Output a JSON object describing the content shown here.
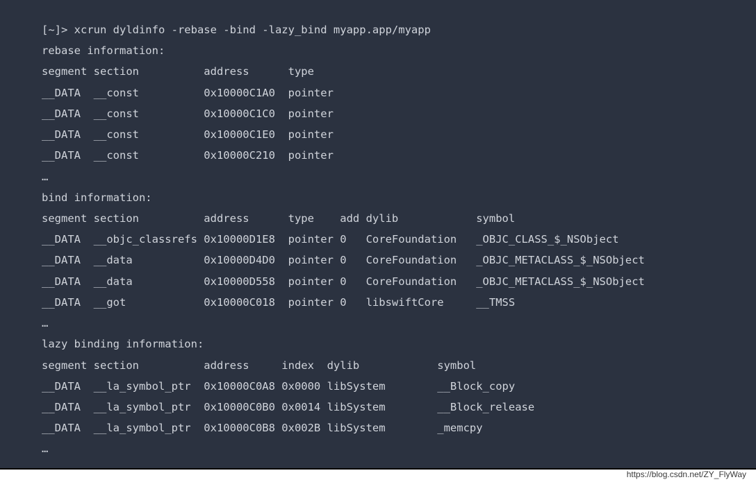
{
  "command": "[~]> xcrun dyldinfo -rebase -bind -lazy_bind myapp.app/myapp",
  "rebase": {
    "title": "rebase information:",
    "header": {
      "segment": "segment",
      "section": "section",
      "address": "address",
      "type": "type"
    },
    "rows": [
      {
        "segment": "__DATA",
        "section": "__const",
        "address": "0x10000C1A0",
        "type": "pointer"
      },
      {
        "segment": "__DATA",
        "section": "__const",
        "address": "0x10000C1C0",
        "type": "pointer"
      },
      {
        "segment": "__DATA",
        "section": "__const",
        "address": "0x10000C1E0",
        "type": "pointer"
      },
      {
        "segment": "__DATA",
        "section": "__const",
        "address": "0x10000C210",
        "type": "pointer"
      }
    ],
    "ellipsis": "…"
  },
  "bind": {
    "title": "bind information:",
    "header": {
      "segment": "segment",
      "section": "section",
      "address": "address",
      "type": "type",
      "add": "add",
      "dylib": "dylib",
      "symbol": "symbol"
    },
    "rows": [
      {
        "segment": "__DATA",
        "section": "__objc_classrefs",
        "address": "0x10000D1E8",
        "type": "pointer",
        "add": "0",
        "dylib": "CoreFoundation",
        "symbol": "_OBJC_CLASS_$_NSObject"
      },
      {
        "segment": "__DATA",
        "section": "__data",
        "address": "0x10000D4D0",
        "type": "pointer",
        "add": "0",
        "dylib": "CoreFoundation",
        "symbol": "_OBJC_METACLASS_$_NSObject"
      },
      {
        "segment": "__DATA",
        "section": "__data",
        "address": "0x10000D558",
        "type": "pointer",
        "add": "0",
        "dylib": "CoreFoundation",
        "symbol": "_OBJC_METACLASS_$_NSObject"
      },
      {
        "segment": "__DATA",
        "section": "__got",
        "address": "0x10000C018",
        "type": "pointer",
        "add": "0",
        "dylib": "libswiftCore",
        "symbol": "__TMSS"
      }
    ],
    "ellipsis": "…"
  },
  "lazy": {
    "title": "lazy binding information:",
    "header": {
      "segment": "segment",
      "section": "section",
      "address": "address",
      "index": "index",
      "dylib": "dylib",
      "symbol": "symbol"
    },
    "rows": [
      {
        "segment": "__DATA",
        "section": "__la_symbol_ptr",
        "address": "0x10000C0A8",
        "index": "0x0000",
        "dylib": "libSystem",
        "symbol": "__Block_copy"
      },
      {
        "segment": "__DATA",
        "section": "__la_symbol_ptr",
        "address": "0x10000C0B0",
        "index": "0x0014",
        "dylib": "libSystem",
        "symbol": "__Block_release"
      },
      {
        "segment": "__DATA",
        "section": "__la_symbol_ptr",
        "address": "0x10000C0B8",
        "index": "0x002B",
        "dylib": "libSystem",
        "symbol": "_memcpy"
      }
    ],
    "ellipsis": "…"
  },
  "watermark": "https://blog.csdn.net/ZY_FlyWay"
}
